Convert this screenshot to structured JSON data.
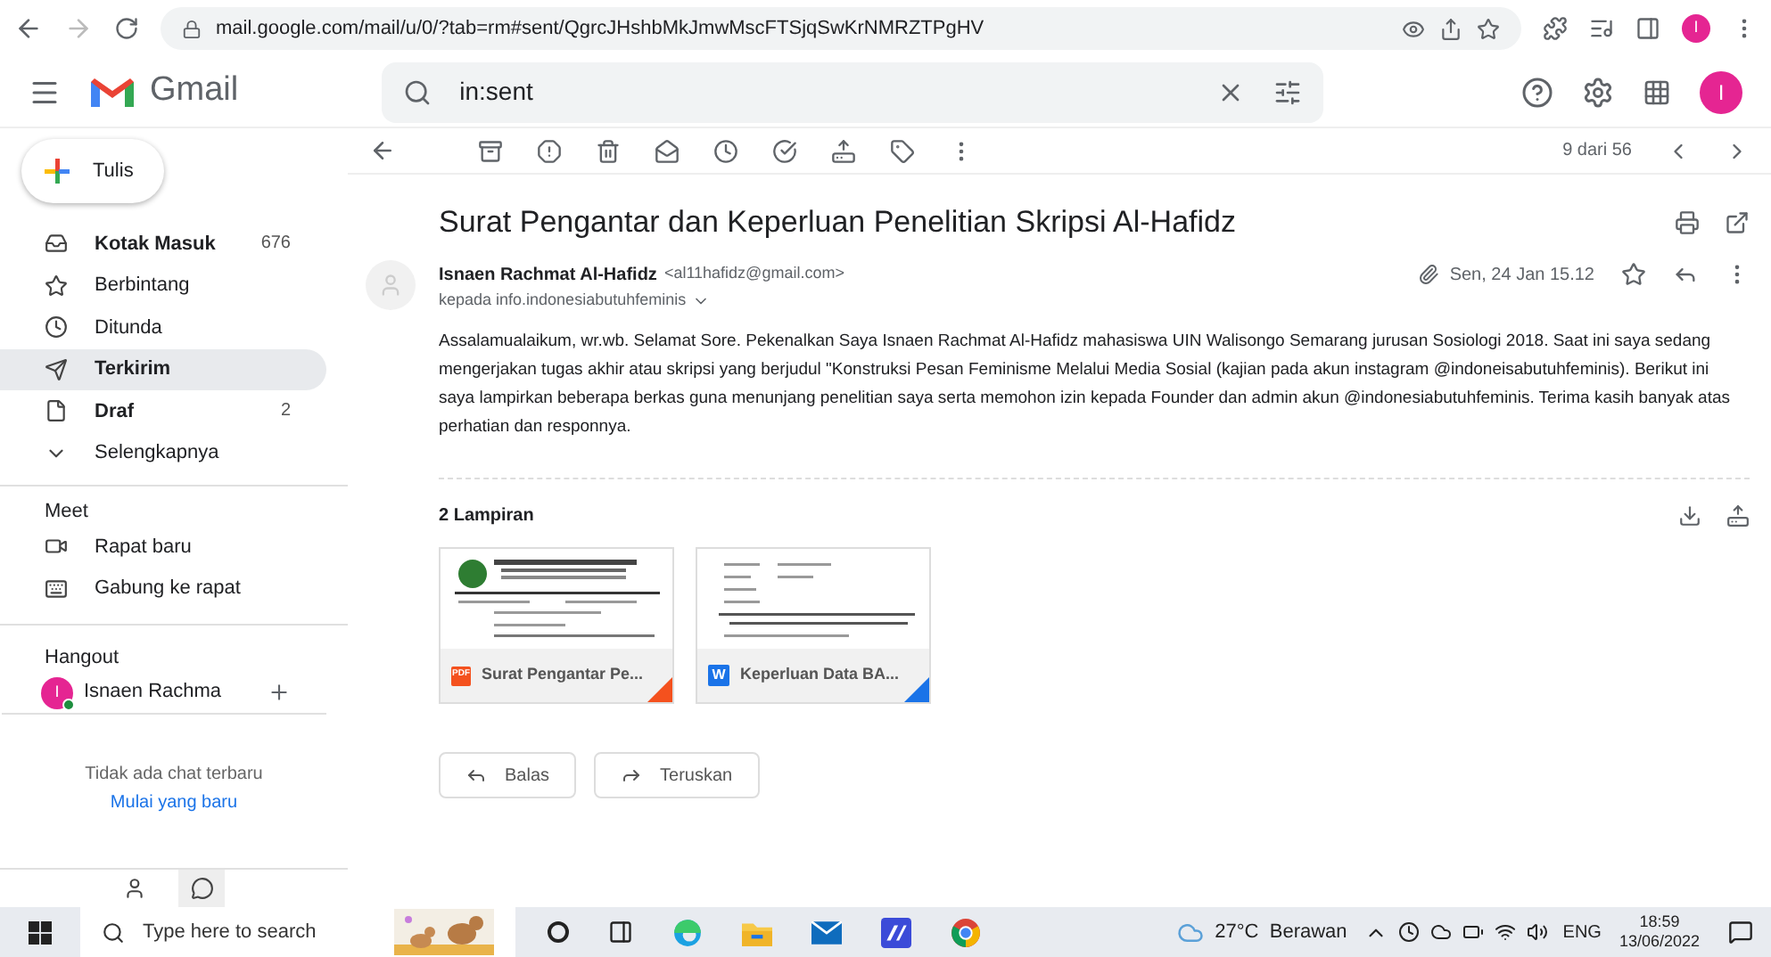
{
  "browser": {
    "url": "mail.google.com/mail/u/0/?tab=rm#sent/QgrcJHshbMkJmwMscFTSjqSwKrNMRZTPgHV",
    "profile_initial": "I"
  },
  "header": {
    "app_name": "Gmail",
    "search_value": "in:sent",
    "avatar_initial": "I"
  },
  "compose": {
    "label": "Tulis"
  },
  "sidebar": {
    "items": [
      {
        "label": "Kotak Masuk",
        "count": "676",
        "kind": "inbox",
        "unread": true,
        "selected": false
      },
      {
        "label": "Berbintang",
        "kind": "star",
        "unread": false,
        "selected": false
      },
      {
        "label": "Ditunda",
        "kind": "clock",
        "unread": false,
        "selected": false
      },
      {
        "label": "Terkirim",
        "kind": "send",
        "unread": true,
        "selected": true
      },
      {
        "label": "Draf",
        "count": "2",
        "kind": "file",
        "unread": true,
        "selected": false
      },
      {
        "label": "Selengkapnya",
        "kind": "chevron",
        "unread": false,
        "selected": false
      }
    ],
    "meet": {
      "title": "Meet",
      "items": [
        {
          "label": "Rapat baru",
          "kind": "video"
        },
        {
          "label": "Gabung ke rapat",
          "kind": "keyboard"
        }
      ]
    },
    "hangout": {
      "title": "Hangout",
      "contact": {
        "initial": "I",
        "name": "Isnaen Rachma",
        "online": true
      },
      "empty_text": "Tidak ada chat terbaru",
      "start_link": "Mulai yang baru"
    }
  },
  "toolbar": {
    "pager": "9 dari 56"
  },
  "message": {
    "subject": "Surat Pengantar dan Keperluan Penelitian Skripsi Al-Hafidz",
    "sender_name": "Isnaen Rachmat Al-Hafidz",
    "sender_email": "<al11hafidz@gmail.com>",
    "recipient": "kepada info.indonesiabutuhfeminis",
    "date": "Sen, 24 Jan 15.12",
    "starred": false,
    "body": "Assalamualaikum, wr.wb. Selamat Sore. Pekenalkan Saya Isnaen Rachmat Al-Hafidz mahasiswa UIN Walisongo Semarang jurusan Sosiologi 2018. Saat ini saya sedang mengerjakan tugas akhir atau skripsi yang berjudul \"Konstruksi Pesan Feminisme Melalui Media Sosial (kajian pada akun instagram @indoneisabutuhfeminis). Berikut ini saya lampirkan beberapa berkas guna menunjang penelitian saya serta memohon izin kepada Founder dan admin akun @indonesiabutuhfeminis. Terima kasih banyak atas perhatian dan responnya.",
    "attachments_title": "2 Lampiran",
    "attachments": [
      {
        "name": "Surat Pengantar Pe...",
        "kind": "pdf",
        "badge": "PDF",
        "color": "#f4511e"
      },
      {
        "name": "Keperluan Data BA...",
        "kind": "doc",
        "badge": "W",
        "color": "#1a73e8"
      }
    ],
    "actions": [
      {
        "label": "Balas",
        "kind": "reply"
      },
      {
        "label": "Teruskan",
        "kind": "forward"
      }
    ]
  },
  "taskbar": {
    "search_placeholder": "Type here to search",
    "weather": "27°C  Berawan",
    "language": "ENG",
    "time": "18:59",
    "date": "13/06/2022"
  }
}
